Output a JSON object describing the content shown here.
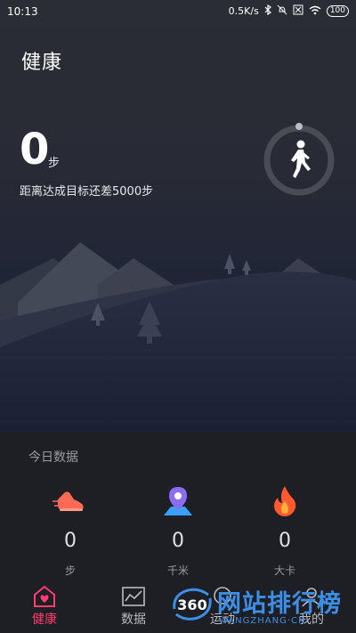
{
  "status": {
    "time": "10:13",
    "network_speed": "0.5K/s",
    "battery": "100"
  },
  "header": {
    "title": "健康"
  },
  "steps": {
    "count": "0",
    "unit": "步",
    "goal_text": "距离达成目标还差5000步"
  },
  "today": {
    "title": "今日数据",
    "stats": [
      {
        "icon": "sneaker-icon",
        "value": "0",
        "unit": "步",
        "color": "#ff6a55"
      },
      {
        "icon": "location-pin-icon",
        "value": "0",
        "unit": "千米",
        "color": "#8a6cf5"
      },
      {
        "icon": "flame-icon",
        "value": "0",
        "unit": "大卡",
        "color": "#ff5a2e"
      }
    ]
  },
  "nav": {
    "items": [
      {
        "label": "健康",
        "icon": "heart-home-icon",
        "active": true
      },
      {
        "label": "数据",
        "icon": "chart-icon",
        "active": false
      },
      {
        "label": "运动",
        "icon": "sport-icon",
        "active": false
      },
      {
        "label": "我的",
        "icon": "profile-icon",
        "active": false
      }
    ]
  },
  "watermark": {
    "logo_text": "360",
    "text": "网站排行榜",
    "sub": "WANGZHANG·CN"
  },
  "colors": {
    "accent": "#ff3d6e",
    "ring": "#4a4c55",
    "watermark": "#3c8fe6"
  }
}
